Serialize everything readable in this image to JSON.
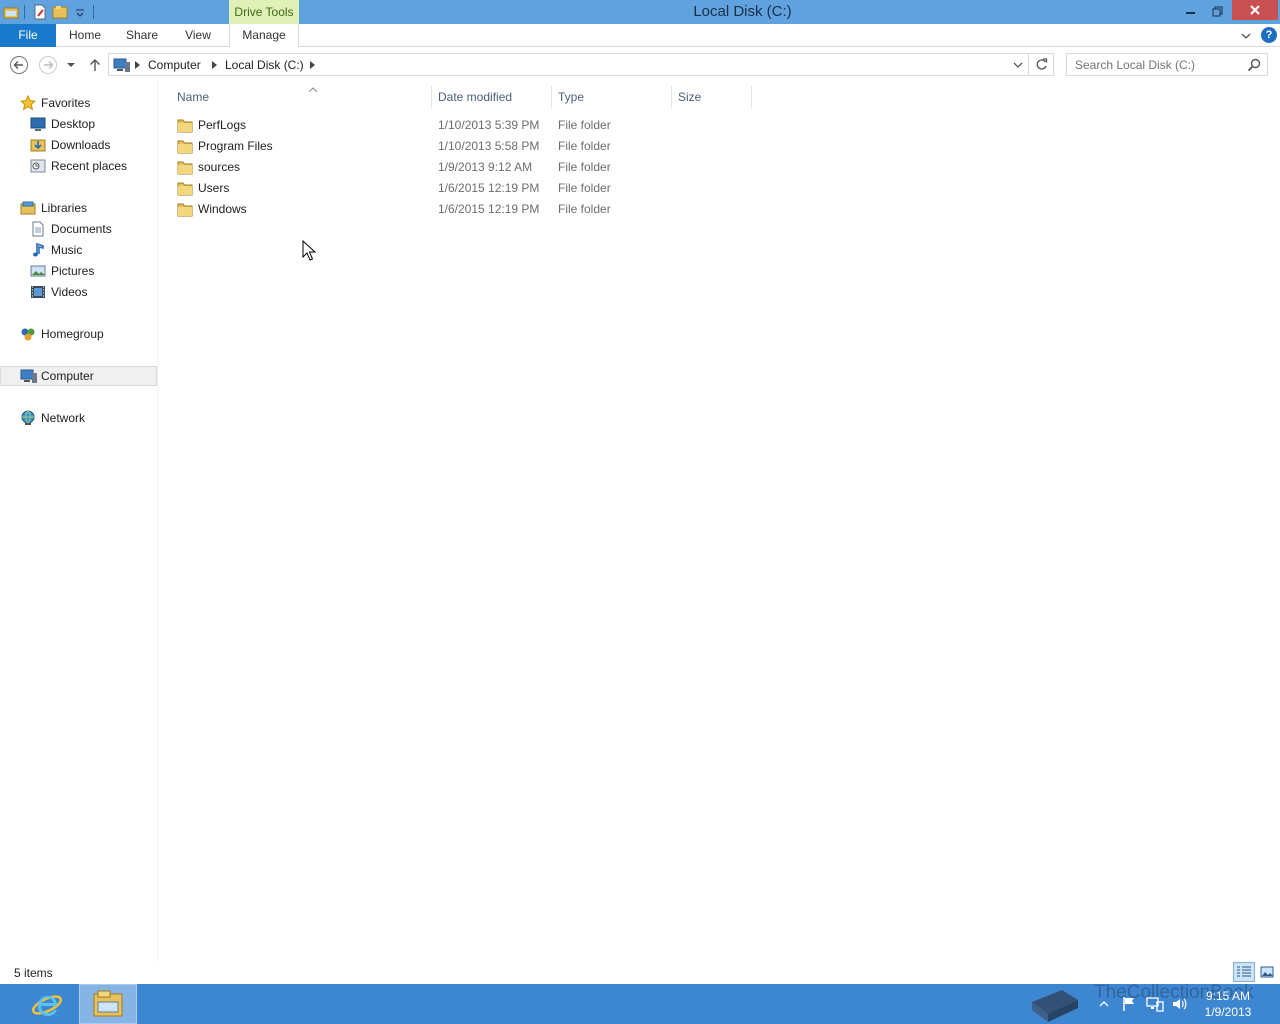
{
  "titlebar": {
    "context_tab_group": "Drive Tools",
    "window_title": "Local Disk (C:)"
  },
  "ribbon": {
    "tabs": [
      {
        "label": "File"
      },
      {
        "label": "Home"
      },
      {
        "label": "Share"
      },
      {
        "label": "View"
      },
      {
        "label": "Manage"
      }
    ]
  },
  "address_bar": {
    "breadcrumbs": [
      "Computer",
      "Local Disk (C:)"
    ],
    "search_placeholder": "Search Local Disk (C:)"
  },
  "navigation_pane": {
    "groups": [
      {
        "label": "Favorites",
        "icon": "star-icon",
        "items": [
          {
            "label": "Desktop",
            "icon": "desktop-icon"
          },
          {
            "label": "Downloads",
            "icon": "downloads-icon"
          },
          {
            "label": "Recent places",
            "icon": "recent-places-icon"
          }
        ]
      },
      {
        "label": "Libraries",
        "icon": "libraries-icon",
        "items": [
          {
            "label": "Documents",
            "icon": "documents-icon"
          },
          {
            "label": "Music",
            "icon": "music-icon"
          },
          {
            "label": "Pictures",
            "icon": "pictures-icon"
          },
          {
            "label": "Videos",
            "icon": "videos-icon"
          }
        ]
      },
      {
        "label": "Homegroup",
        "icon": "homegroup-icon",
        "items": []
      },
      {
        "label": "Computer",
        "icon": "computer-icon",
        "items": [],
        "selected": true
      },
      {
        "label": "Network",
        "icon": "network-icon",
        "items": []
      }
    ]
  },
  "file_list": {
    "columns": [
      "Name",
      "Date modified",
      "Type",
      "Size"
    ],
    "sorted_by": "Name",
    "rows": [
      {
        "name": "PerfLogs",
        "date_modified": "1/10/2013 5:39 PM",
        "type": "File folder",
        "size": ""
      },
      {
        "name": "Program Files",
        "date_modified": "1/10/2013 5:58 PM",
        "type": "File folder",
        "size": ""
      },
      {
        "name": "sources",
        "date_modified": "1/9/2013 9:12 AM",
        "type": "File folder",
        "size": ""
      },
      {
        "name": "Users",
        "date_modified": "1/6/2015 12:19 PM",
        "type": "File folder",
        "size": ""
      },
      {
        "name": "Windows",
        "date_modified": "1/6/2015 12:19 PM",
        "type": "File folder",
        "size": ""
      }
    ]
  },
  "status_bar": {
    "item_count": "5 items"
  },
  "taskbar": {
    "watermark": "TheCollectionBook",
    "clock_time": "9:15 AM",
    "clock_date": "1/9/2013"
  },
  "colors": {
    "titlebar": "#5fa2dd",
    "file_tab": "#1979ca",
    "drive_tools": "#dff0b8",
    "close_button": "#c75050",
    "taskbar": "#3d86d1",
    "folder": "#e8c15a"
  }
}
